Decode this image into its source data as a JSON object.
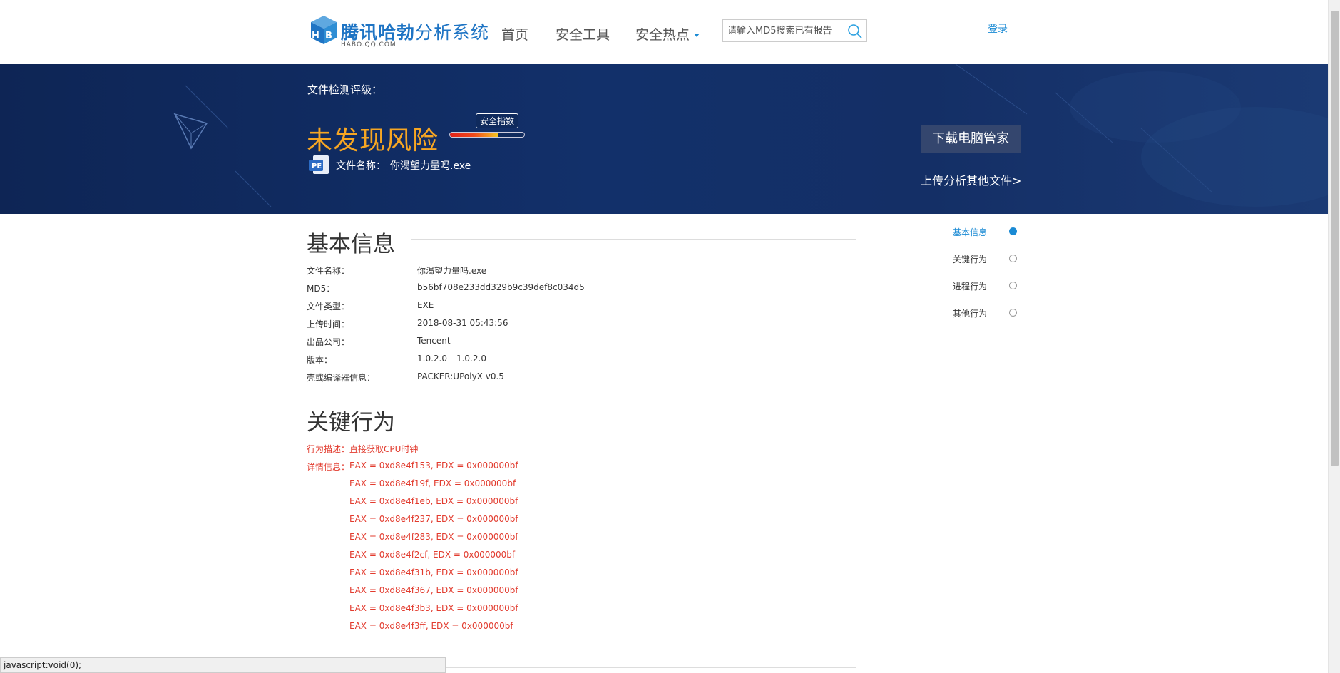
{
  "header": {
    "logo_title_bold": "腾讯哈勃",
    "logo_title_light": "分析系统",
    "logo_subtitle": "HABO.QQ.COM",
    "nav": [
      "首页",
      "安全工具",
      "安全热点"
    ],
    "search_placeholder": "请输入MD5搜索已有报告",
    "login_label": "登录"
  },
  "banner": {
    "label": "文件检测评级：",
    "risk_title": "未发现风险",
    "gauge_label": "安全指数",
    "gauge_level": 0.64,
    "file_icon_text": "PE",
    "file_name_label": "文件名称：",
    "file_name": "你渴望力量吗.exe",
    "download_button": "下载电脑管家",
    "upload_link": "上传分析其他文件>"
  },
  "basic_info": {
    "title": "基本信息",
    "rows": [
      {
        "label": "文件名称：",
        "value": "你渴望力量吗.exe"
      },
      {
        "label": "MD5：",
        "value": "b56bf708e233dd329b9c39def8c034d5"
      },
      {
        "label": "文件类型：",
        "value": "EXE"
      },
      {
        "label": "上传时间：",
        "value": "2018-08-31 05:43:56"
      },
      {
        "label": "出品公司：",
        "value": "Tencent"
      },
      {
        "label": "版本：",
        "value": "1.0.2.0---1.0.2.0"
      },
      {
        "label": "壳或编译器信息：",
        "value": "PACKER:UPolyX v0.5"
      }
    ]
  },
  "key_behavior": {
    "title": "关键行为",
    "desc_label": "行为描述：",
    "desc_value": "直接获取CPU时钟",
    "detail_label": "详情信息：",
    "details": [
      "EAX = 0xd8e4f153, EDX = 0x000000bf",
      "EAX = 0xd8e4f19f, EDX = 0x000000bf",
      "EAX = 0xd8e4f1eb, EDX = 0x000000bf",
      "EAX = 0xd8e4f237, EDX = 0x000000bf",
      "EAX = 0xd8e4f283, EDX = 0x000000bf",
      "EAX = 0xd8e4f2cf, EDX = 0x000000bf",
      "EAX = 0xd8e4f31b, EDX = 0x000000bf",
      "EAX = 0xd8e4f367, EDX = 0x000000bf",
      "EAX = 0xd8e4f3b3, EDX = 0x000000bf",
      "EAX = 0xd8e4f3ff, EDX = 0x000000bf"
    ]
  },
  "side_nav": {
    "items": [
      "基本信息",
      "关键行为",
      "进程行为",
      "其他行为"
    ],
    "active_index": 0
  },
  "status_bar": {
    "text": "javascript:void(0);"
  },
  "colors": {
    "brand_blue": "#1e74c4",
    "link_blue": "#1a8ad4",
    "risk_orange": "#f6a623",
    "alert_red": "#e23b2e",
    "banner_navy": "#12306a"
  }
}
